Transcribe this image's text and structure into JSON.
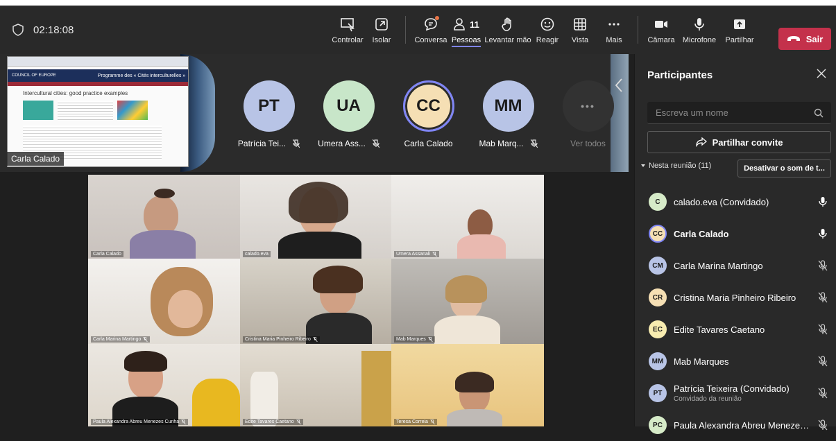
{
  "toolbar": {
    "timer": "02:18:08",
    "buttons": {
      "controlar": "Controlar",
      "isolar": "Isolar",
      "conversa": "Conversa",
      "pessoas": "Pessoas",
      "pessoas_count": "11",
      "levantar": "Levantar mão",
      "reagir": "Reagir",
      "vista": "Vista",
      "mais": "Mais",
      "camara": "Câmara",
      "microfone": "Microfone",
      "partilhar": "Partilhar"
    },
    "leave": "Sair"
  },
  "share": {
    "presenter": "Carla Calado",
    "page_heading": "Intercultural cities: good practice examples",
    "page_program": "Programme des « Cités interculturelles »",
    "org": "COUNCIL OF EUROPE"
  },
  "gallery": [
    {
      "initials": "PT",
      "name": "Patrícia Tei...",
      "color": "#b8c4e6"
    },
    {
      "initials": "UA",
      "name": "Umera Ass...",
      "color": "#c8e6c9"
    },
    {
      "initials": "CC",
      "name": "Carla Calado",
      "color": "#f5dfb4"
    },
    {
      "initials": "MM",
      "name": "Mab Marq...",
      "color": "#b8c4e6"
    }
  ],
  "gallery_more": "Ver todos",
  "tiles": [
    {
      "name": "Carla Calado"
    },
    {
      "name": "calado.eva"
    },
    {
      "name": "Umera Assanali"
    },
    {
      "name": "Carla Marina Martingo"
    },
    {
      "name": "Cristina Maria Pinheiro Ribeiro"
    },
    {
      "name": "Mab Marques"
    },
    {
      "name": "Paula Alexandra Abreu Menezes Cunha"
    },
    {
      "name": "Edite Tavares Caetano"
    },
    {
      "name": "Teresa Correia"
    }
  ],
  "panel": {
    "title": "Participantes",
    "search_placeholder": "Escreva um nome",
    "invite": "Partilhar convite",
    "section": "Nesta reunião (11)",
    "mute_all": "Desativar o som de t...",
    "participants": [
      {
        "initials": "C",
        "name": "calado.eva (Convidado)",
        "color": "#d6ebc8",
        "mic": "on"
      },
      {
        "initials": "CC",
        "name": "Carla Calado",
        "color": "#f5dfb4",
        "mic": "on",
        "bold": true
      },
      {
        "initials": "CM",
        "name": "Carla Marina Martingo",
        "color": "#b8c4e6",
        "mic": "off"
      },
      {
        "initials": "CR",
        "name": "Cristina Maria Pinheiro Ribeiro",
        "color": "#f5dfb4",
        "mic": "off"
      },
      {
        "initials": "EC",
        "name": "Edite Tavares Caetano",
        "color": "#f8ecb0",
        "mic": "off"
      },
      {
        "initials": "MM",
        "name": "Mab Marques",
        "color": "#b8c4e6",
        "mic": "off"
      },
      {
        "initials": "PT",
        "name": "Patrícia Teixeira (Convidado)",
        "sub": "Convidado da reunião",
        "color": "#b8c4e6",
        "mic": "off"
      },
      {
        "initials": "PC",
        "name": "Paula Alexandra Abreu Menezes ...",
        "color": "#d6ebc8",
        "mic": "off"
      }
    ]
  }
}
